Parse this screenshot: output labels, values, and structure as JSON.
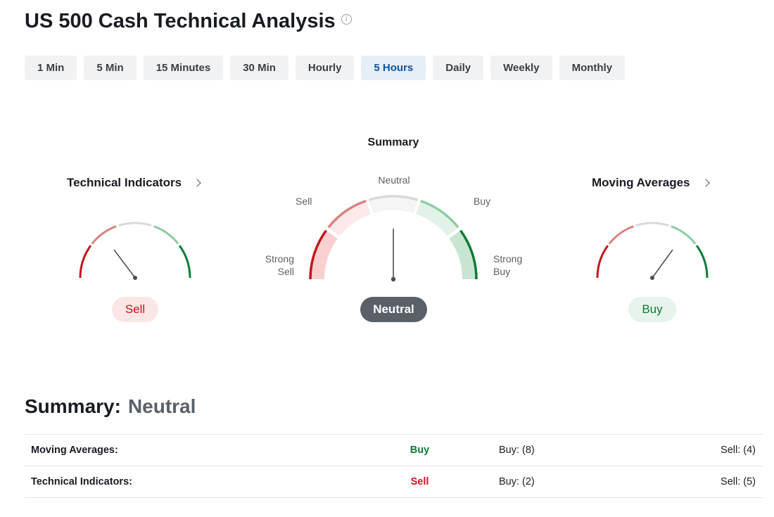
{
  "header": {
    "title": "US 500 Cash Technical Analysis",
    "info_icon": "info-icon"
  },
  "tabs": [
    {
      "label": "1 Min",
      "active": false
    },
    {
      "label": "5 Min",
      "active": false
    },
    {
      "label": "15 Minutes",
      "active": false
    },
    {
      "label": "30 Min",
      "active": false
    },
    {
      "label": "Hourly",
      "active": false
    },
    {
      "label": "5 Hours",
      "active": true
    },
    {
      "label": "Daily",
      "active": false
    },
    {
      "label": "Weekly",
      "active": false
    },
    {
      "label": "Monthly",
      "active": false
    }
  ],
  "gauges": {
    "summary_label": "Summary",
    "technical": {
      "title": "Technical Indicators",
      "value": "Sell"
    },
    "summary": {
      "value": "Neutral",
      "labels": {
        "strong_sell_1": "Strong",
        "strong_sell_2": "Sell",
        "sell": "Sell",
        "neutral": "Neutral",
        "buy": "Buy",
        "strong_buy_1": "Strong",
        "strong_buy_2": "Buy"
      }
    },
    "moving": {
      "title": "Moving Averages",
      "value": "Buy"
    }
  },
  "summary": {
    "label": "Summary:",
    "value": "Neutral",
    "rows": [
      {
        "name": "Moving Averages:",
        "action": "Buy",
        "buy": "Buy: (8)",
        "sell": "Sell: (4)"
      },
      {
        "name": "Technical Indicators:",
        "action": "Sell",
        "buy": "Buy: (2)",
        "sell": "Sell: (5)"
      }
    ]
  },
  "colors": {
    "strong_sell": "#c4161c",
    "sell": "#d9837e",
    "neutral": "#d7d9dc",
    "buy": "#8fcca2",
    "strong_buy": "#0f7a35",
    "active_tab": "#1255a0"
  }
}
